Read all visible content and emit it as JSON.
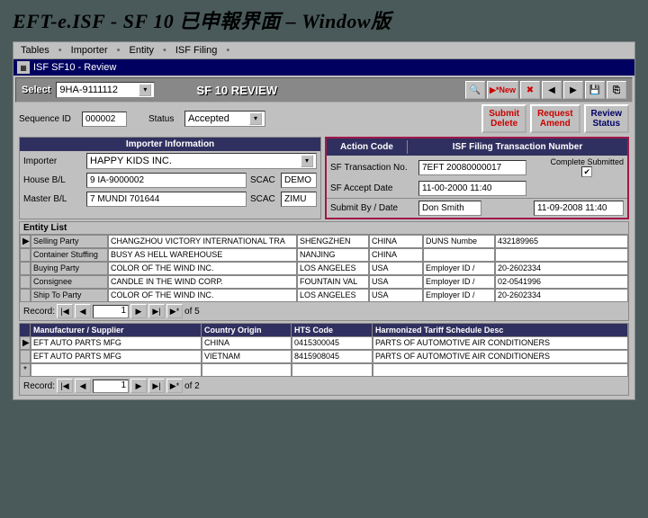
{
  "slide_title": "EFT-e.ISF  -    SF 10 已申報界面 – Window版",
  "menu": {
    "items": [
      "Tables",
      "Importer",
      "Entity",
      "ISF Filing"
    ]
  },
  "window": {
    "title": "ISF SF10 - Review"
  },
  "toolbar": {
    "select_label": "Select",
    "select_value": "9HA-9111112",
    "title": "SF 10 REVIEW",
    "new_label": "New"
  },
  "seq": {
    "seq_label": "Sequence ID",
    "seq_value": "000002",
    "status_label": "Status",
    "status_value": "Accepted"
  },
  "buttons": {
    "submit": "Submit",
    "delete": "Delete",
    "request": "Request",
    "amend": "Amend",
    "review": "Review",
    "status": "Status"
  },
  "left": {
    "header": "Importer Information",
    "importer_label": "Importer",
    "importer_value": "HAPPY KIDS INC.",
    "house_label": "House B/L",
    "house_value": "9 IA-9000002",
    "house_scac_label": "SCAC",
    "house_scac": "DEMO",
    "master_label": "Master B/L",
    "master_value": "7 MUNDI 701644",
    "master_scac_label": "SCAC",
    "master_scac": "ZIMU"
  },
  "right": {
    "header1": "Action Code",
    "header2": "ISF Filing Transaction Number",
    "txn_label": "SF Transaction No.",
    "txn_value": "7EFT 20080000017",
    "complete_label": "Complete Submitted",
    "accept_label": "SF Accept Date",
    "accept_value": "11-00-2000 11:40",
    "submit_label": "Submit By / Date",
    "submit_by": "Don Smith",
    "submit_date": "11-09-2008 11:40"
  },
  "entity": {
    "title": "Entity List",
    "cols": [
      "",
      "",
      "",
      "",
      "",
      ""
    ],
    "rows": [
      {
        "mark": "▶",
        "role": "Selling Party",
        "name": "CHANGZHOU VICTORY INTERNATIONAL TRA",
        "city": "SHENGZHEN",
        "country": "CHINA",
        "idlabel": "DUNS Numbe",
        "idval": "432189965"
      },
      {
        "mark": "",
        "role": "Container Stuffing",
        "name": "BUSY AS HELL WAREHOUSE",
        "city": "NANJING",
        "country": "CHINA",
        "idlabel": "",
        "idval": ""
      },
      {
        "mark": "",
        "role": "Buying Party",
        "name": "COLOR OF THE WIND INC.",
        "city": "LOS ANGELES",
        "country": "USA",
        "idlabel": "Employer ID /",
        "idval": "20-2602334"
      },
      {
        "mark": "",
        "role": "Consignee",
        "name": "CANDLE IN THE WIND CORP.",
        "city": "FOUNTAIN VAL",
        "country": "USA",
        "idlabel": "Employer ID /",
        "idval": "02-0541996"
      },
      {
        "mark": "",
        "role": "Ship To Party",
        "name": "COLOR OF THE WIND INC.",
        "city": "LOS ANGELES",
        "country": "USA",
        "idlabel": "Employer ID /",
        "idval": "20-2602334"
      }
    ],
    "record_label": "Record:",
    "record_pos": "1",
    "record_of": "of  5"
  },
  "hts": {
    "headers": [
      "Manufacturer / Supplier",
      "Country Origin",
      "HTS Code",
      "Harmonized Tariff Schedule Desc"
    ],
    "rows": [
      {
        "mark": "▶",
        "mfg": "EFT AUTO PARTS MFG",
        "country": "CHINA",
        "code": "0415300045",
        "desc": "PARTS OF AUTOMOTIVE AIR CONDITIONERS"
      },
      {
        "mark": "",
        "mfg": "EFT AUTO PARTS MFG",
        "country": "VIETNAM",
        "code": "8415908045",
        "desc": "PARTS OF AUTOMOTIVE AIR CONDITIONERS"
      },
      {
        "mark": "*",
        "mfg": "",
        "country": "",
        "code": "",
        "desc": ""
      }
    ],
    "record_label": "Record:",
    "record_pos": "1",
    "record_of": "of  2"
  }
}
